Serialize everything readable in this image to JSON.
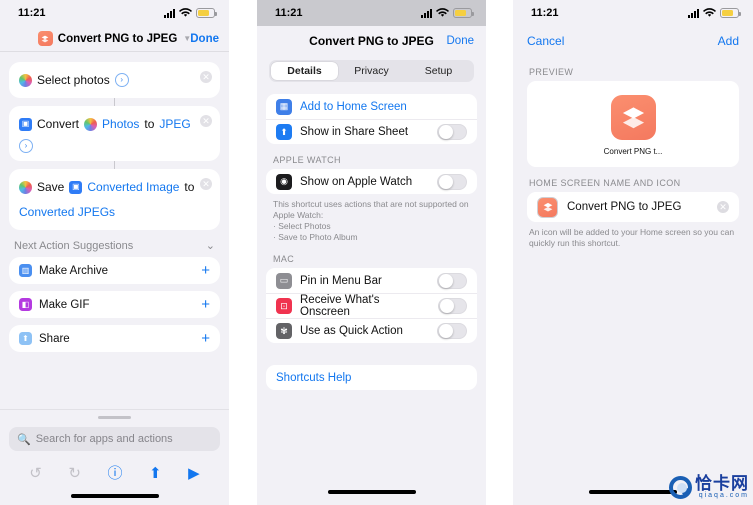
{
  "status_bar": {
    "time": "11:21",
    "signal_icon": "cellular-bars-icon",
    "wifi_icon": "wifi-icon",
    "battery_icon": "battery-icon",
    "battery_color": "#f5cf41"
  },
  "panel_editor": {
    "title": "Convert PNG to JPEG",
    "chevron_icon": "chevron-down-icon",
    "done_label": "Done",
    "actions": [
      {
        "icon": "photos-icon",
        "parts": [
          {
            "text": "Select photos",
            "style": "plain"
          }
        ],
        "disclosure_icon": "chevron-right-circle-icon",
        "remove_icon": "remove-icon"
      },
      {
        "icon": "convert-image-icon",
        "parts": [
          {
            "text": "Convert",
            "style": "plain"
          },
          {
            "text": "Photos",
            "style": "token",
            "token_icon": "photos-icon"
          },
          {
            "text": "to",
            "style": "plain"
          },
          {
            "text": "JPEG",
            "style": "token"
          }
        ],
        "disclosure_icon": "chevron-right-circle-icon",
        "remove_icon": "remove-icon"
      },
      {
        "icon": "photos-icon",
        "parts": [
          {
            "text": "Save",
            "style": "plain"
          },
          {
            "text": "Converted Image",
            "style": "token",
            "token_icon": "convert-image-icon"
          },
          {
            "text": "to",
            "style": "plain"
          },
          {
            "text": "Converted JPEGs",
            "style": "token"
          }
        ],
        "remove_icon": "remove-icon"
      }
    ],
    "suggestions_header": "Next Action Suggestions",
    "suggestions_chevron_icon": "chevron-down-icon",
    "suggestions": [
      {
        "label": "Make Archive",
        "icon": "archive-icon",
        "icon_color": "#4a8ff0",
        "add_icon": "plus-icon"
      },
      {
        "label": "Make GIF",
        "icon": "gif-icon",
        "icon_color": "#b43ae0",
        "add_icon": "plus-icon"
      },
      {
        "label": "Share",
        "icon": "share-icon",
        "icon_color": "#8ec2f5",
        "add_icon": "plus-icon"
      }
    ],
    "search_placeholder": "Search for apps and actions",
    "search_icon": "search-icon",
    "grabber": "drag-handle",
    "toolbar": [
      {
        "name": "undo-icon",
        "glyph": "↺",
        "enabled": false
      },
      {
        "name": "redo-icon",
        "glyph": "↻",
        "enabled": false
      },
      {
        "name": "info-icon",
        "glyph": "ⓘ",
        "enabled": true
      },
      {
        "name": "share-icon",
        "glyph": "⬆",
        "enabled": true
      },
      {
        "name": "play-icon",
        "glyph": "▶",
        "enabled": true
      }
    ]
  },
  "panel_details": {
    "title": "Convert PNG to JPEG",
    "done_label": "Done",
    "tabs": [
      {
        "label": "Details",
        "selected": true
      },
      {
        "label": "Privacy",
        "selected": false
      },
      {
        "label": "Setup",
        "selected": false
      }
    ],
    "main_group": [
      {
        "label": "Add to Home Screen",
        "icon": "home-screen-icon",
        "icon_color": "#3f7fe8",
        "link": true
      },
      {
        "label": "Show in Share Sheet",
        "icon": "share-sheet-icon",
        "icon_color": "#1e7cf2",
        "toggle": "off"
      }
    ],
    "apple_watch_header": "APPLE WATCH",
    "apple_watch_group": [
      {
        "label": "Show on Apple Watch",
        "icon": "apple-watch-icon",
        "icon_color": "#1c1c1e",
        "toggle": "off"
      }
    ],
    "apple_watch_footnote": "This shortcut uses actions that are not supported on Apple Watch:",
    "apple_watch_footnote_items": [
      "· Select Photos",
      "· Save to Photo Album"
    ],
    "mac_header": "MAC",
    "mac_group": [
      {
        "label": "Pin in Menu Bar",
        "icon": "menu-bar-icon",
        "icon_color": "#8e8e93",
        "toggle": "off"
      },
      {
        "label": "Receive What's Onscreen",
        "icon": "onscreen-icon",
        "icon_color": "#f0334f",
        "toggle": "off"
      },
      {
        "label": "Use as Quick Action",
        "icon": "quick-action-gear-icon",
        "icon_color": "#636366",
        "toggle": "off"
      }
    ],
    "help_link": "Shortcuts Help"
  },
  "panel_add": {
    "cancel_label": "Cancel",
    "add_label": "Add",
    "preview_header": "PREVIEW",
    "preview_app_label": "Convert PNG t...",
    "preview_icon": "shortcut-layers-icon",
    "name_header": "HOME SCREEN NAME AND ICON",
    "name_value": "Convert PNG to JPEG",
    "name_icon": "shortcut-layers-icon",
    "clear_icon": "clear-field-icon",
    "footnote": "An icon will be added to your Home screen so you can quickly run this shortcut."
  },
  "watermark": {
    "cn_text": "恰卡网",
    "en_text": "qiaqa.com",
    "logo_icon": "qiaqa-logo-icon"
  }
}
